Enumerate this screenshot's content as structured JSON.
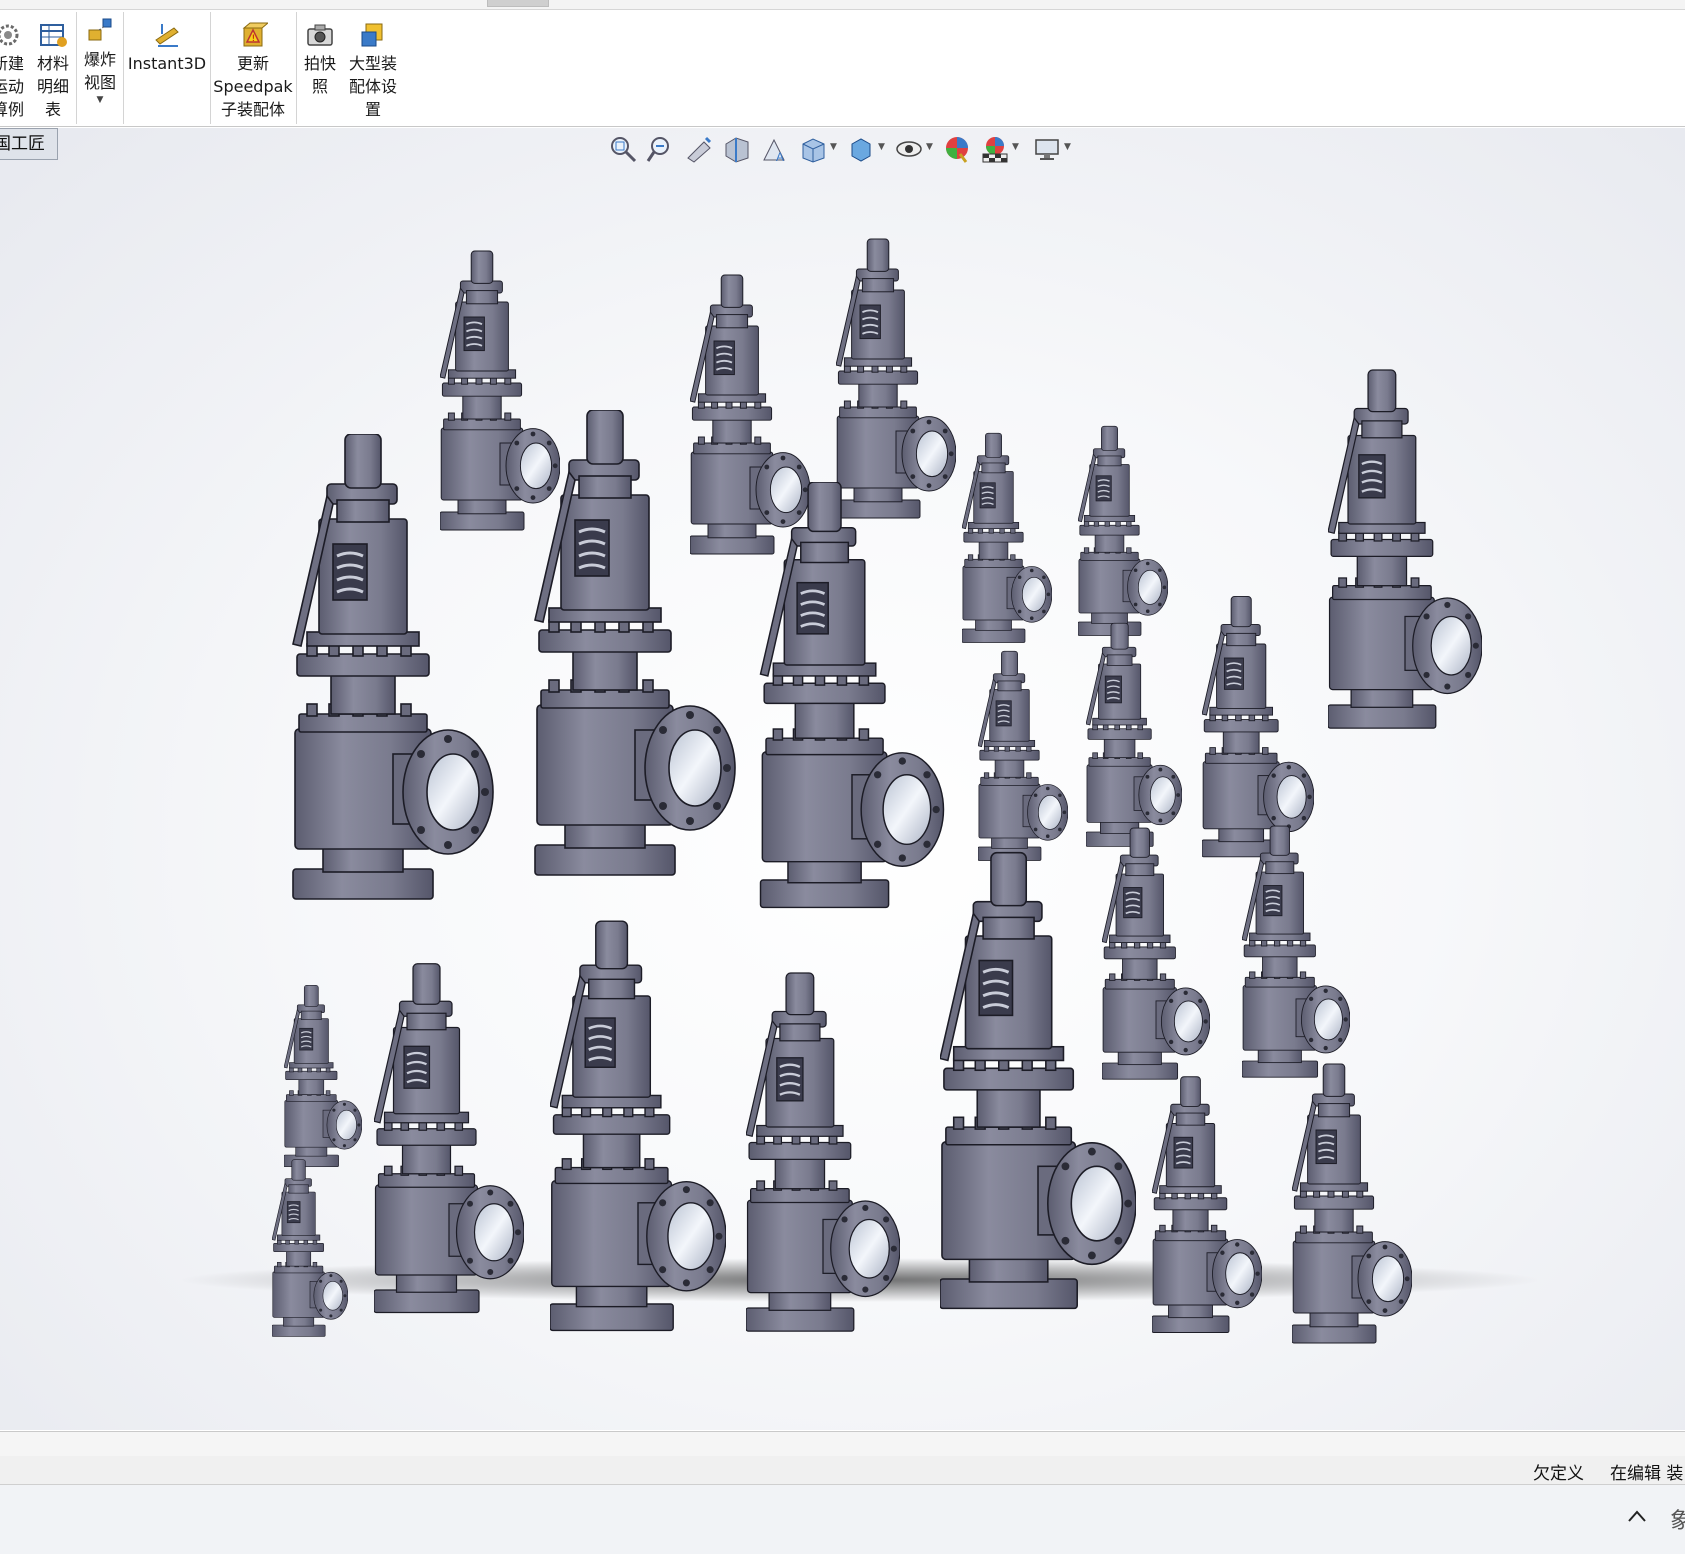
{
  "ribbon": {
    "new_motion_study": "新建\n运动\n算例",
    "bom": "材料\n明细\n表",
    "exploded_view": "爆炸\n视图",
    "instant3d": "Instant3D",
    "update_speedpak": "更新\nSpeedpak\n子装配体",
    "snapshot": "拍快\n照",
    "large_assembly": "大型装\n配体设\n置"
  },
  "feature_tree_tab": "国工匠",
  "hud_icons": [
    "zoom-to-fit-icon",
    "zoom-to-area-icon",
    "previous-view-icon",
    "section-view-icon",
    "dynamic-annotation-icon",
    "view-orientation-icon",
    "display-style-icon",
    "hide-show-icon",
    "edit-appearance-icon",
    "apply-scene-icon",
    "view-settings-icon"
  ],
  "status": {
    "definition": "欠定义",
    "editing": "在编辑 装"
  },
  "taskbar": {
    "chevron": "^",
    "fragment": "象"
  },
  "colors": {
    "valve_body": "#7a7b8e",
    "valve_dark": "#4a4b5c",
    "valve_light": "#a4a5b6",
    "flange_bore": "#dfe6f0"
  }
}
